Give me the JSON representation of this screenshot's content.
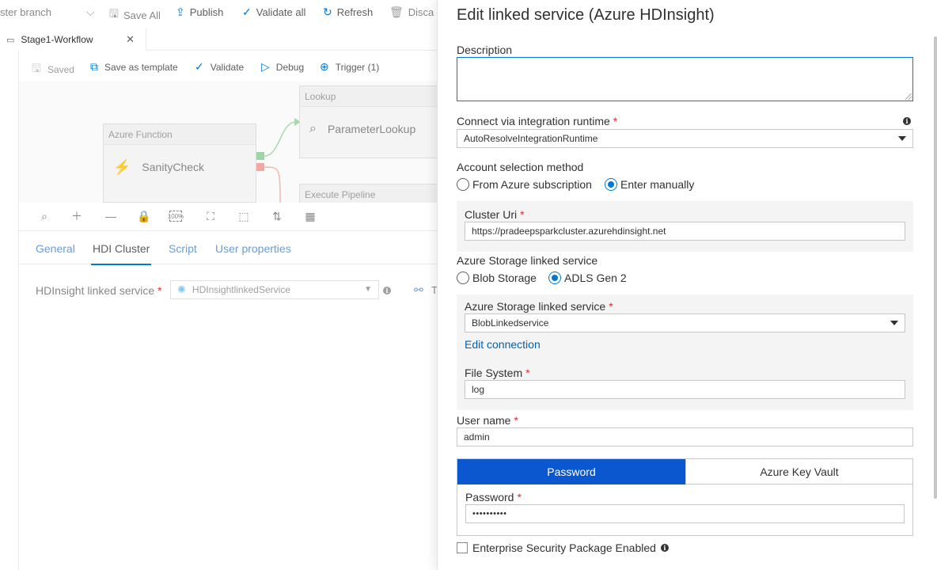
{
  "top_toolbar": {
    "branch_label": "ster branch",
    "save_all": "Save All",
    "publish": "Publish",
    "validate_all": "Validate all",
    "refresh": "Refresh",
    "discard": "Disca"
  },
  "doc_tab": {
    "title": "Stage1-Workflow"
  },
  "canvas_toolbar": {
    "saved": "Saved",
    "save_as_template": "Save as template",
    "validate": "Validate",
    "debug": "Debug",
    "trigger": "Trigger (1)"
  },
  "canvas": {
    "nodes": [
      {
        "type": "Azure Function",
        "name": "SanityCheck"
      },
      {
        "type": "Lookup",
        "name": "ParameterLookup"
      },
      {
        "type": "Execute Pipeline",
        "name": ""
      }
    ]
  },
  "zoom_toolbar": {
    "zoom_100_label": "100%"
  },
  "property_tabs": [
    "General",
    "HDI Cluster",
    "Script",
    "User properties"
  ],
  "hdi": {
    "label": "HDInsight linked service",
    "required_mark": "*",
    "value": "HDInsightlinkedService",
    "test_label": "T"
  },
  "panel": {
    "title": "Edit linked service (Azure HDInsight)",
    "description_label": "Description",
    "description_value": "",
    "ir_label": "Connect via integration runtime",
    "ir_value": "AutoResolveIntegrationRuntime",
    "account_method_label": "Account selection method",
    "account_method_options": [
      "From Azure subscription",
      "Enter manually"
    ],
    "account_method_selected": "Enter manually",
    "cluster_uri_label": "Cluster Uri",
    "cluster_uri_value": "https://pradeepsparkcluster.azurehdinsight.net",
    "storage_type_label": "Azure Storage linked service",
    "storage_type_options": [
      "Blob Storage",
      "ADLS Gen 2"
    ],
    "storage_type_selected": "ADLS Gen 2",
    "storage_ls_label": "Azure Storage linked service",
    "storage_ls_value": "BlobLinkedservice",
    "edit_connection": "Edit connection",
    "file_system_label": "File System",
    "file_system_value": "log",
    "username_label": "User name",
    "username_value": "admin",
    "auth_tabs": [
      "Password",
      "Azure Key Vault"
    ],
    "auth_selected": "Password",
    "password_label": "Password",
    "password_value": "••••••••••",
    "esp_label": "Enterprise Security Package Enabled",
    "required_mark": "*"
  },
  "colors": {
    "accent": "#0078d4",
    "active_tab": "#0b57d0",
    "required": "#d13438",
    "link": "#0062b3"
  }
}
